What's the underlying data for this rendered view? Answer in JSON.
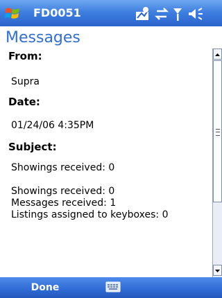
{
  "window": {
    "title": "FD0051"
  },
  "page": {
    "title": "Messages"
  },
  "message": {
    "from_label": "From:",
    "from_value": "Supra",
    "date_label": "Date:",
    "date_value": "01/24/06 4:35PM",
    "subject_label": "Subject:",
    "subject_value": "Showings received: 0",
    "body_lines": [
      "Showings received: 0",
      "Messages received: 1",
      "Listings assigned to keyboxes: 0"
    ]
  },
  "menubar": {
    "left_softkey": "Done"
  },
  "icons": {
    "start": "windows-flag-icon",
    "status": [
      "connectivity-icon",
      "data-transfer-icon",
      "signal-icon",
      "volume-icon"
    ],
    "input_panel": "keyboard-icon"
  },
  "colors": {
    "title_bar": "#3f7fe0",
    "page_title": "#2f6fd6",
    "menubar": "#2f6bd3"
  }
}
